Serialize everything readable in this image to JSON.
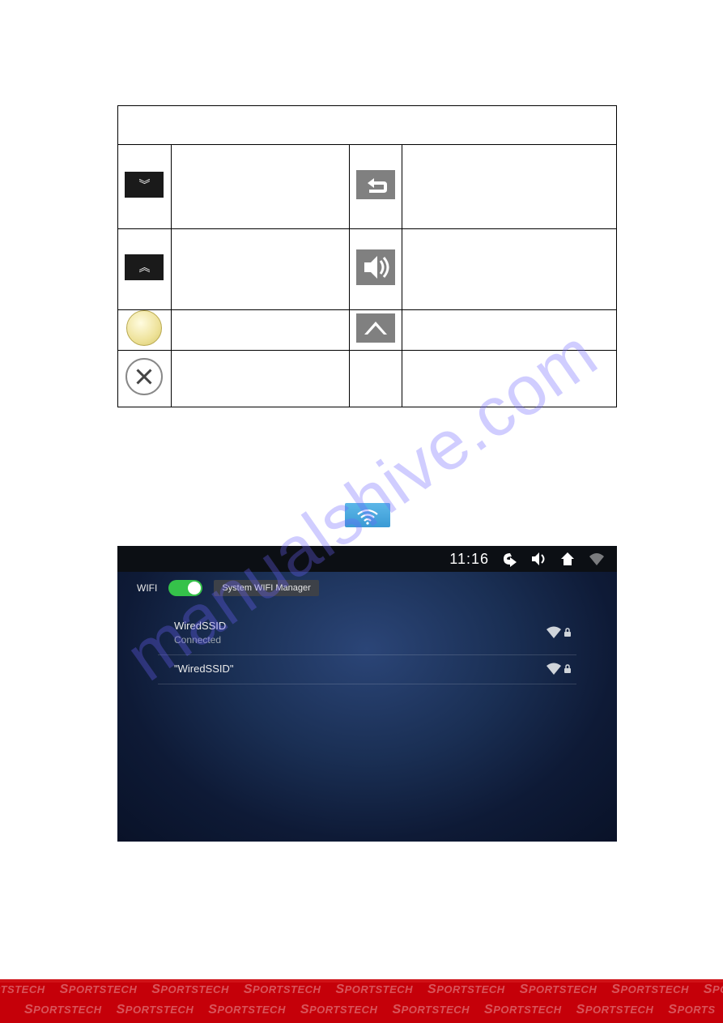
{
  "table": {
    "header": "",
    "rows": [
      {
        "left_icon": "chevrons-down",
        "left_text": "",
        "right_icon": "return-arrow",
        "right_text": ""
      },
      {
        "left_icon": "chevrons-up",
        "left_text": "",
        "right_icon": "speaker",
        "right_text": ""
      },
      {
        "left_icon": "yellow-ball",
        "left_text": "",
        "right_icon": "house-outline",
        "right_text": ""
      },
      {
        "left_icon": "close-circle",
        "left_text": "",
        "right_icon": "",
        "right_text": ""
      }
    ]
  },
  "inline_wifi_tile": "wifi",
  "screenshot": {
    "statusbar": {
      "time": "11:16",
      "icons": [
        "back",
        "volume",
        "home",
        "wifi"
      ]
    },
    "toolbar": {
      "wifi_label": "WIFI",
      "toggle_on": true,
      "manager_button": "System WIFI Manager"
    },
    "networks": [
      {
        "ssid": "WiredSSID",
        "status": "Connected",
        "secured": true
      },
      {
        "ssid": "\"WiredSSID\"",
        "status": "",
        "secured": true
      }
    ]
  },
  "watermark": "manualshive.com",
  "footer_brand": "SPORTSTECH"
}
